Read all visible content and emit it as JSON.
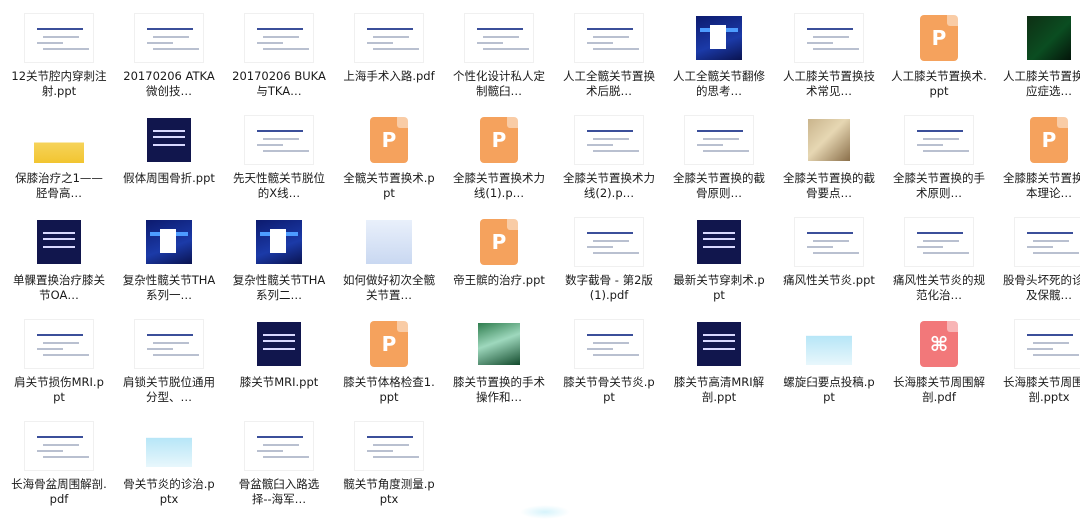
{
  "files": [
    {
      "label": "12关节腔内穿刺注射.ppt",
      "thumb": "white"
    },
    {
      "label": "20170206 ATKA微创技…",
      "thumb": "white"
    },
    {
      "label": "20170206 BUKA与TKA…",
      "thumb": "white"
    },
    {
      "label": "上海手术入路.pdf",
      "thumb": "white"
    },
    {
      "label": "个性化设计私人定制髋臼…",
      "thumb": "white"
    },
    {
      "label": "人工全髋关节置换术后脱…",
      "thumb": "white"
    },
    {
      "label": "人工全髋关节翻修的思考…",
      "thumb": "blue"
    },
    {
      "label": "人工膝关节置换技术常见…",
      "thumb": "white"
    },
    {
      "label": "人工膝关节置换术.ppt",
      "thumb": "ppt"
    },
    {
      "label": "人工膝关节置换适应症选…",
      "thumb": "dark"
    },
    {
      "label": "保膝治疗之1——胫骨高…",
      "thumb": "yellow"
    },
    {
      "label": "假体周围骨折.ppt",
      "thumb": "navy"
    },
    {
      "label": "先天性髋关节脱位的X线…",
      "thumb": "white"
    },
    {
      "label": "全髋关节置换术.ppt",
      "thumb": "ppt"
    },
    {
      "label": "全膝关节置换术力线(1).p…",
      "thumb": "ppt"
    },
    {
      "label": "全膝关节置换术力线(2).p…",
      "thumb": "white"
    },
    {
      "label": "全膝关节置换的截骨原则…",
      "thumb": "white"
    },
    {
      "label": "全膝关节置换的截骨要点…",
      "thumb": "photo"
    },
    {
      "label": "全膝关节置换的手术原则…",
      "thumb": "white"
    },
    {
      "label": "全膝膝关节置换基本理论…",
      "thumb": "ppt"
    },
    {
      "label": "单髁置换治疗膝关节OA…",
      "thumb": "navy"
    },
    {
      "label": "复杂性髋关节THA系列一…",
      "thumb": "blue"
    },
    {
      "label": "复杂性髋关节THA系列二…",
      "thumb": "blue"
    },
    {
      "label": "如何做好初次全髋关节置…",
      "thumb": "pale"
    },
    {
      "label": "帝王髌的治疗.ppt",
      "thumb": "ppt"
    },
    {
      "label": "数字截骨 - 第2版(1).pdf",
      "thumb": "white"
    },
    {
      "label": "最新关节穿刺术.ppt",
      "thumb": "navy"
    },
    {
      "label": "痛风性关节炎.ppt",
      "thumb": "white"
    },
    {
      "label": "痛风性关节炎的规范化治…",
      "thumb": "white"
    },
    {
      "label": "股骨头坏死的诊断及保髋…",
      "thumb": "white"
    },
    {
      "label": "肩关节损伤MRI.ppt",
      "thumb": "white"
    },
    {
      "label": "肩锁关节脱位通用分型、…",
      "thumb": "white"
    },
    {
      "label": "膝关节MRI.ppt",
      "thumb": "navy"
    },
    {
      "label": "膝关节体格检查1.ppt",
      "thumb": "ppt"
    },
    {
      "label": "膝关节置换的手术操作和…",
      "thumb": "green"
    },
    {
      "label": "膝关节骨关节炎.ppt",
      "thumb": "white"
    },
    {
      "label": "膝关节高清MRI解剖.ppt",
      "thumb": "navy"
    },
    {
      "label": "螺旋臼要点投稿.ppt",
      "thumb": "cyan"
    },
    {
      "label": "长海膝关节周围解剖.pdf",
      "thumb": "pdf"
    },
    {
      "label": "长海膝关节周围解剖.pptx",
      "thumb": "white"
    },
    {
      "label": "长海骨盆周围解剖.pdf",
      "thumb": "white"
    },
    {
      "label": "骨关节炎的诊治.pptx",
      "thumb": "cyan"
    },
    {
      "label": "骨盆髋臼入路选择--海军…",
      "thumb": "white"
    },
    {
      "label": "髋关节角度测量.pptx",
      "thumb": "white"
    }
  ],
  "icons": {
    "ppt": {
      "glyph": "P",
      "color": "#f5a25d"
    },
    "pdf": {
      "glyph": "⌘",
      "color": "#f2787a"
    }
  }
}
